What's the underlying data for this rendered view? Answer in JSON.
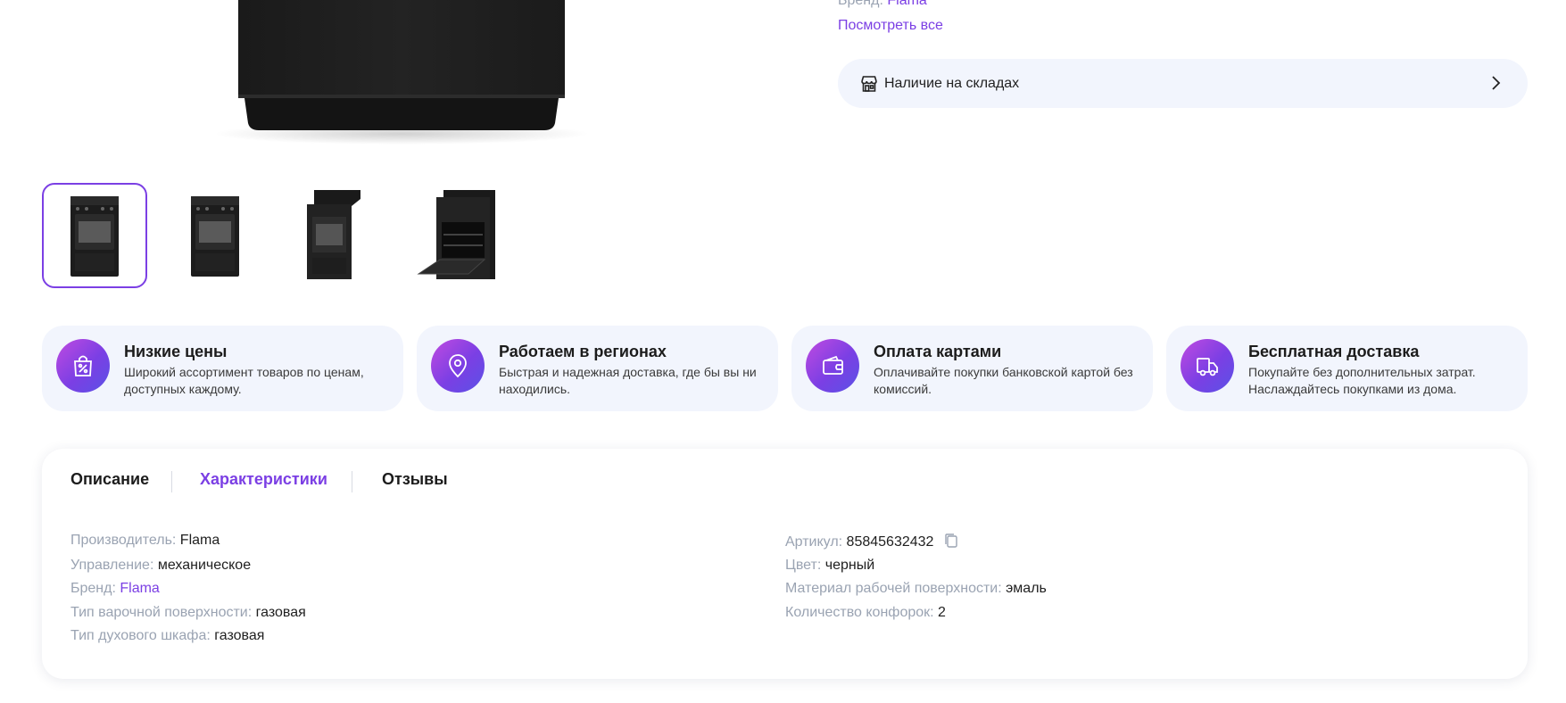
{
  "product": {
    "brand_label": "Бренд:",
    "brand_value": "Flama",
    "see_all_label": "Посмотреть все",
    "stock_label": "Наличие на складах"
  },
  "thumbnails": [
    {
      "icon": "stove-front-thumbnail",
      "active": true
    },
    {
      "icon": "stove-front-thumbnail",
      "active": false
    },
    {
      "icon": "stove-side-thumbnail",
      "active": false
    },
    {
      "icon": "stove-open-door-thumbnail",
      "active": false
    }
  ],
  "features": [
    {
      "title": "Низкие цены",
      "desc": "Широкий ассортимент товаров по ценам, доступных каждому.",
      "icon": "shopping-bag-percent-icon"
    },
    {
      "title": "Работаем в регионах",
      "desc": "Быстрая и надежная доставка, где бы вы ни находились.",
      "icon": "map-pin-icon"
    },
    {
      "title": "Оплата картами",
      "desc": "Оплачивайте покупки банковской картой без комиссий.",
      "icon": "wallet-icon"
    },
    {
      "title": "Бесплатная доставка",
      "desc": "Покупайте без дополнительных затрат. Наслаждайтесь покупками из дома.",
      "icon": "delivery-truck-icon"
    }
  ],
  "tabs": [
    {
      "label": "Описание",
      "active": false
    },
    {
      "label": "Характеристики",
      "active": true
    },
    {
      "label": "Отзывы",
      "active": false
    }
  ],
  "specs_left": [
    {
      "key": "Производитель:",
      "value": "Flama"
    },
    {
      "key": "Управление:",
      "value": "механическое"
    },
    {
      "key": "Бренд:",
      "value": "Flama"
    },
    {
      "key": "Тип варочной поверхности:",
      "value": "газовая"
    },
    {
      "key": "Тип духового шкафа:",
      "value": "газовая"
    }
  ],
  "specs_right": [
    {
      "key": "Артикул:",
      "value": "85845632432"
    },
    {
      "key": "Цвет:",
      "value": "черный"
    },
    {
      "key": "Материал рабочей поверхности:",
      "value": "эмаль"
    },
    {
      "key": "Количество конфорок:",
      "value": "2"
    }
  ],
  "colors": {
    "accent": "#7b3fe4",
    "card_bg": "#f2f5fd",
    "muted_text": "#9aa3b2"
  }
}
